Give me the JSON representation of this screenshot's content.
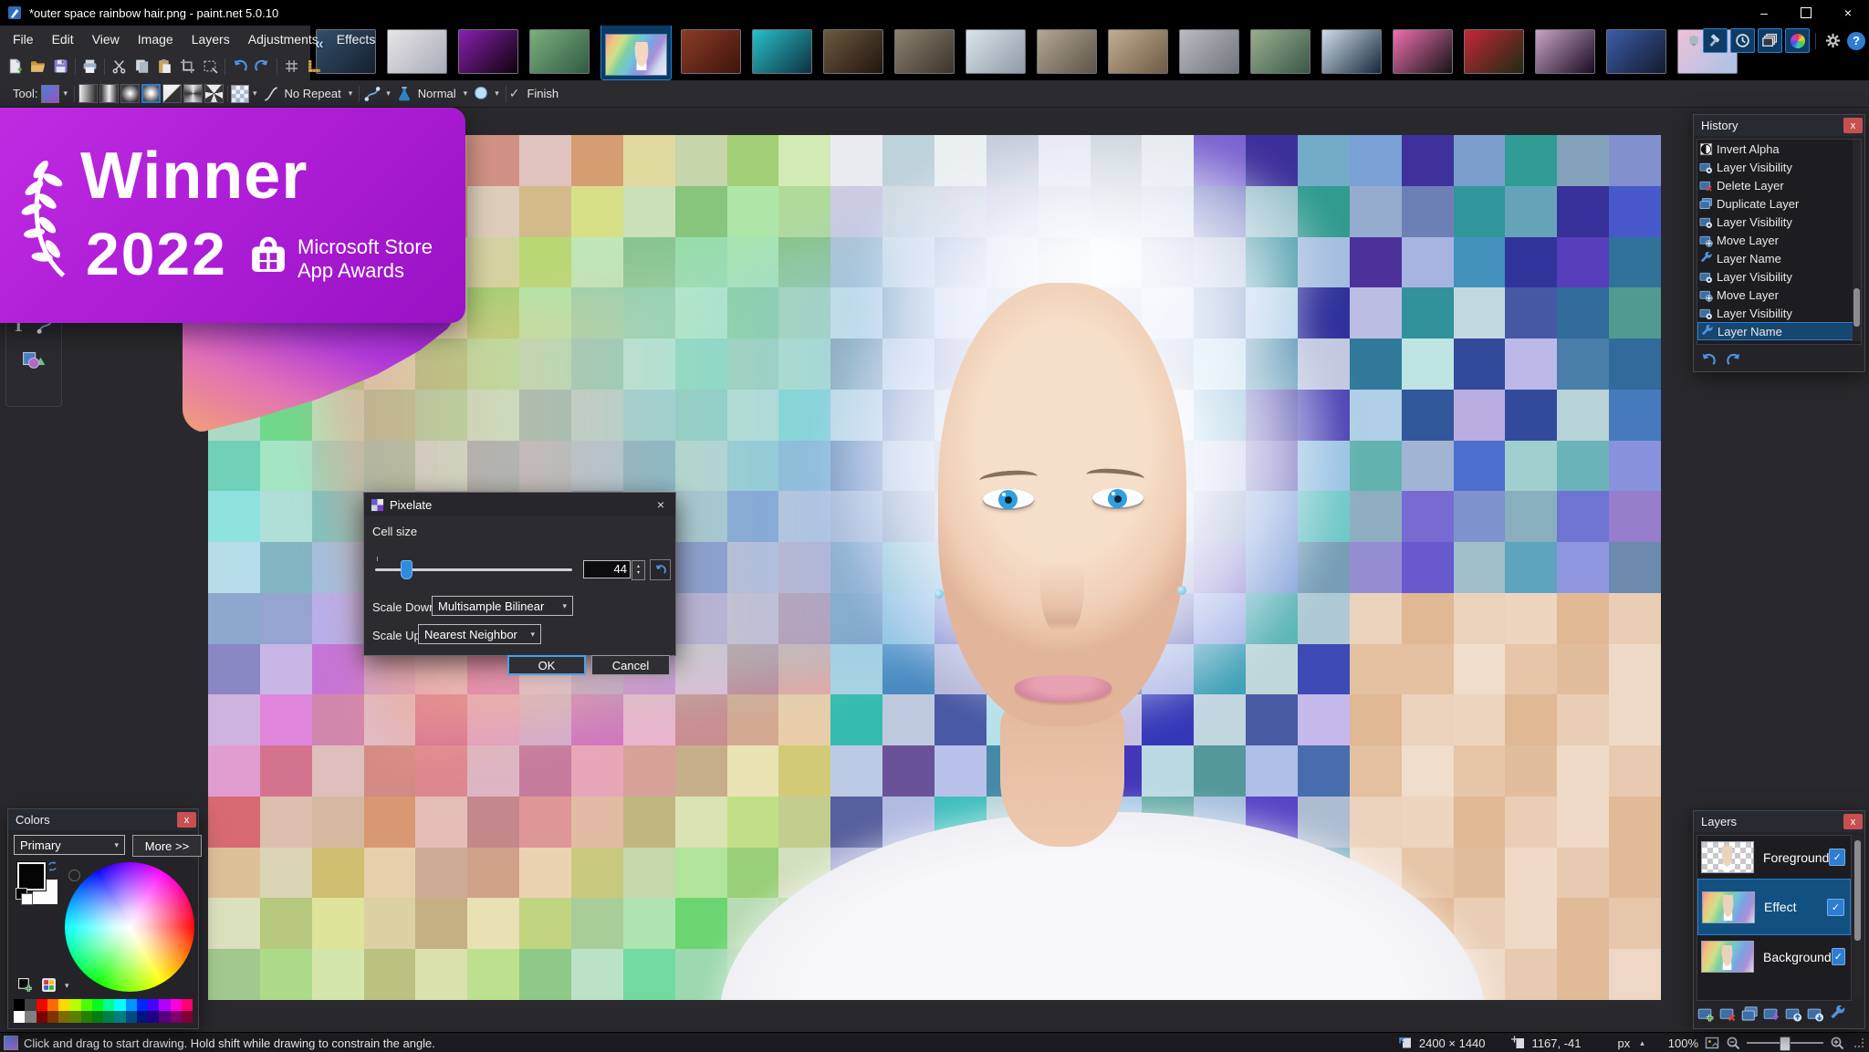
{
  "window": {
    "title": "*outer space rainbow hair.png - paint.net 5.0.10"
  },
  "glyphs": {
    "dropdown": "▾",
    "up": "▴",
    "down": "▾",
    "minimize": "–",
    "close": "×",
    "help": "?",
    "check": "✓",
    "chevron_left": "«",
    "text_tool": "T",
    "ellipsis_x": "x"
  },
  "menu": {
    "items": [
      "File",
      "Edit",
      "View",
      "Image",
      "Layers",
      "Adjustments",
      "Effects"
    ]
  },
  "toolbar_main": {
    "icons": [
      "new",
      "open",
      "save",
      "|",
      "print",
      "|",
      "cut",
      "copy",
      "paste",
      "crop",
      "deselect",
      "|",
      "undo",
      "redo",
      "|",
      "grid",
      "ruler"
    ]
  },
  "tool_options": {
    "tool_label": "Tool:",
    "gradient_selected_index": 3,
    "repeat_label": "No Repeat",
    "blend_label": "Normal",
    "finish_label": "Finish"
  },
  "thumbnails": {
    "selected_index": 4,
    "items": [
      {
        "name": "desk-photo",
        "from": "#35506b",
        "to": "#14202e"
      },
      {
        "name": "cat-in-blanket",
        "from": "#e7e4e6",
        "to": "#a8acb8"
      },
      {
        "name": "rainbow-arc",
        "from": "#8a1fb0",
        "to": "#0d030a"
      },
      {
        "name": "kitten",
        "from": "#7fae7e",
        "to": "#2e5c44"
      },
      {
        "name": "rainbow-hair-portrait",
        "from": "#7fa5e0",
        "to": "#e9bcd6"
      },
      {
        "name": "red-cat",
        "from": "#8a3b27",
        "to": "#3f140d"
      },
      {
        "name": "night-city",
        "from": "#27c0c9",
        "to": "#0d3140"
      },
      {
        "name": "shipwreck",
        "from": "#6b5a41",
        "to": "#21150c"
      },
      {
        "name": "wolf",
        "from": "#8d8271",
        "to": "#3a332a"
      },
      {
        "name": "snow-mountain",
        "from": "#dbe4ec",
        "to": "#8f9aa6"
      },
      {
        "name": "crowd",
        "from": "#b3a795",
        "to": "#5d5347"
      },
      {
        "name": "tabby-cat",
        "from": "#c3ad92",
        "to": "#6e5b44"
      },
      {
        "name": "stone-building",
        "from": "#b9bcc2",
        "to": "#70747c"
      },
      {
        "name": "forest-cliff",
        "from": "#9bae8d",
        "to": "#39584a"
      },
      {
        "name": "night-lake",
        "from": "#cfdbe6",
        "to": "#15293d"
      },
      {
        "name": "black-cat-pink",
        "from": "#ef6fb0",
        "to": "#141414"
      },
      {
        "name": "red-rose",
        "from": "#c52736",
        "to": "#1d2b13"
      },
      {
        "name": "milky-way",
        "from": "#c9a4c6",
        "to": "#170b20"
      },
      {
        "name": "christmas-street",
        "from": "#3c5ba8",
        "to": "#131b2e"
      },
      {
        "name": "pink-marble",
        "from": "#f0c0d8",
        "to": "#a9c3e8"
      }
    ]
  },
  "banner": {
    "title": "Winner",
    "year": "2022",
    "org_line1": "Microsoft Store",
    "org_line2": "App Awards"
  },
  "dialog": {
    "title": "Pixelate",
    "cell_size_label": "Cell size",
    "cell_size_value": "44",
    "scale_down_label": "Scale Down:",
    "scale_down_value": "Multisample Bilinear",
    "scale_up_label": "Scale Up:",
    "scale_up_value": "Nearest Neighbor",
    "ok_label": "OK",
    "cancel_label": "Cancel"
  },
  "history": {
    "title": "History",
    "selected_index": 10,
    "items": [
      {
        "icon": "invert-alpha",
        "label": "Invert Alpha"
      },
      {
        "icon": "layer-visibility",
        "label": "Layer Visibility"
      },
      {
        "icon": "delete-layer",
        "label": "Delete Layer"
      },
      {
        "icon": "duplicate-layer",
        "label": "Duplicate Layer"
      },
      {
        "icon": "layer-visibility",
        "label": "Layer Visibility"
      },
      {
        "icon": "move-layer",
        "label": "Move Layer"
      },
      {
        "icon": "layer-name",
        "label": "Layer Name"
      },
      {
        "icon": "layer-visibility",
        "label": "Layer Visibility"
      },
      {
        "icon": "move-layer",
        "label": "Move Layer"
      },
      {
        "icon": "layer-visibility",
        "label": "Layer Visibility"
      },
      {
        "icon": "layer-name",
        "label": "Layer Name"
      }
    ]
  },
  "layers": {
    "title": "Layers",
    "items": [
      {
        "name": "Foreground",
        "selected": false,
        "visible": true
      },
      {
        "name": "Effect",
        "selected": true,
        "visible": true
      },
      {
        "name": "Background",
        "selected": false,
        "visible": true
      }
    ],
    "buttons": [
      "add-layer",
      "delete-layer",
      "duplicate-layer",
      "merge-down",
      "move-up-btn",
      "move-down-btn",
      "layer-name"
    ]
  },
  "colors": {
    "title": "Colors",
    "mode": "Primary",
    "more_label": "More >>",
    "palette_row1": [
      "#000000",
      "#404040",
      "#ff0000",
      "#ff6a00",
      "#ffd800",
      "#b6ff00",
      "#4cff00",
      "#00ff21",
      "#00ff90",
      "#00ffff",
      "#0094ff",
      "#0026ff",
      "#4800ff",
      "#b200ff",
      "#ff00dc",
      "#ff006e"
    ],
    "palette_row2": [
      "#ffffff",
      "#808080",
      "#7f0000",
      "#7f3300",
      "#7f6a00",
      "#5b7f00",
      "#267f00",
      "#007f0e",
      "#007f46",
      "#007f7f",
      "#004a7f",
      "#00137f",
      "#21007f",
      "#57007f",
      "#7f006e",
      "#7f0037"
    ]
  },
  "status": {
    "message": "Click and drag to start drawing. Hold shift while drawing to constrain the angle.",
    "image_size": "2400 × 1440",
    "cursor_pos": "1167, -41",
    "units": "px",
    "zoom": "100%"
  },
  "accent": {
    "selection_blue": "#2d7dd2",
    "panel_close_red": "#c75050"
  }
}
